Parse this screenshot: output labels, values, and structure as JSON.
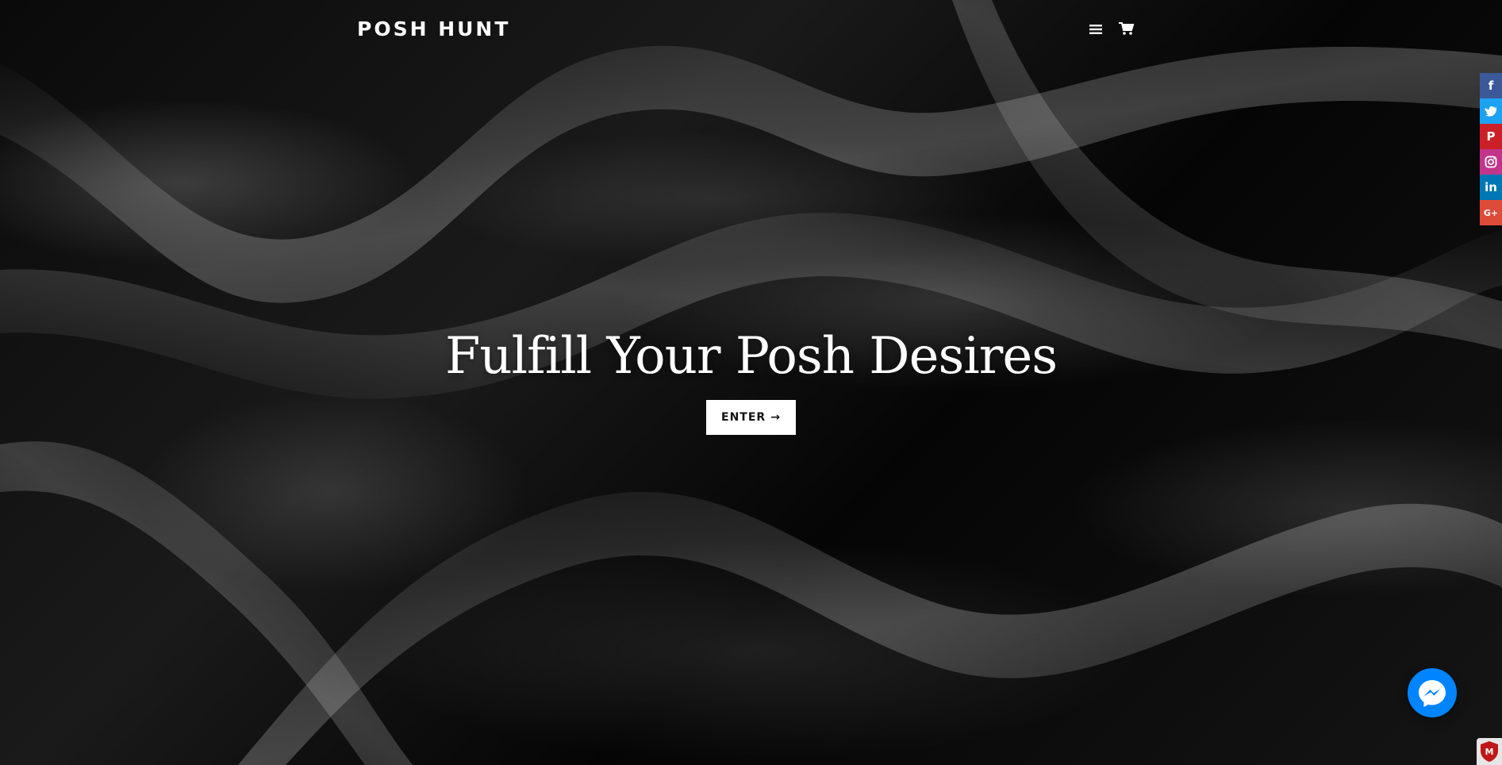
{
  "header": {
    "logo_text": "POSH HUNT",
    "menu_icon": "hamburger-menu-icon",
    "cart_icon": "shopping-cart-icon"
  },
  "hero": {
    "headline": "Fulfill Your Posh Desires",
    "cta_label": "ENTER",
    "cta_arrow": "→",
    "background": "black-silk-fabric"
  },
  "social_bar": {
    "items": [
      {
        "name": "facebook",
        "glyph": "f",
        "color": "#3b5998"
      },
      {
        "name": "twitter",
        "glyph": "t",
        "color": "#1da1f2"
      },
      {
        "name": "pinterest",
        "glyph": "P",
        "color": "#cb2027"
      },
      {
        "name": "instagram",
        "glyph": "◎",
        "color": "#c1358a"
      },
      {
        "name": "linkedin",
        "glyph": "in",
        "color": "#0077b5"
      },
      {
        "name": "google-plus",
        "glyph": "G+",
        "color": "#dd4b39"
      }
    ]
  },
  "widgets": {
    "messenger_icon": "messenger-icon",
    "messenger_color": "#0084ff",
    "security_badge_icon": "mcafee-shield-icon",
    "security_badge_glyph": "M"
  }
}
